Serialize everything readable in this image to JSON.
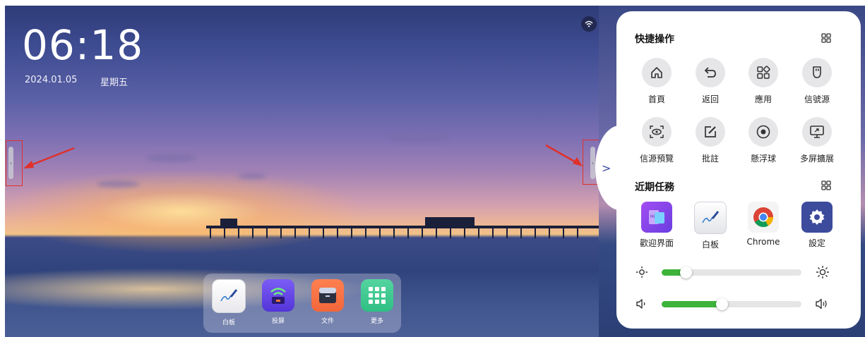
{
  "clock": {
    "time": "06:18",
    "date": "2024.01.05",
    "weekday": "星期五"
  },
  "status": {
    "wifi_icon": "wifi-icon"
  },
  "dock": {
    "items": [
      {
        "label": "白板",
        "icon": "whiteboard-icon"
      },
      {
        "label": "投屏",
        "icon": "screen-cast-icon"
      },
      {
        "label": "文件",
        "icon": "folder-icon"
      },
      {
        "label": "更多",
        "icon": "app-grid-icon"
      }
    ]
  },
  "panel": {
    "quick_title": "快捷操作",
    "quick_actions": [
      {
        "label": "首頁",
        "icon": "home-icon"
      },
      {
        "label": "返回",
        "icon": "back-icon"
      },
      {
        "label": "應用",
        "icon": "apps-icon"
      },
      {
        "label": "信號源",
        "icon": "signal-source-icon"
      },
      {
        "label": "信源預覽",
        "icon": "source-preview-icon"
      },
      {
        "label": "批註",
        "icon": "annotate-icon"
      },
      {
        "label": "懸浮球",
        "icon": "floating-ball-icon"
      },
      {
        "label": "多屏擴展",
        "icon": "multi-screen-icon"
      }
    ],
    "recent_title": "近期任務",
    "recent_tasks": [
      {
        "label": "歡迎界面",
        "icon": "welcome-app-icon"
      },
      {
        "label": "白板",
        "icon": "whiteboard-app-icon"
      },
      {
        "label": "Chrome",
        "icon": "chrome-icon"
      },
      {
        "label": "設定",
        "icon": "settings-icon"
      }
    ],
    "brightness": {
      "value": 0.17
    },
    "volume": {
      "value": 0.43
    }
  },
  "colors": {
    "slider_fill": "#3db33a",
    "annotation_red": "#e0302a",
    "accent": "#3d4aa0"
  }
}
